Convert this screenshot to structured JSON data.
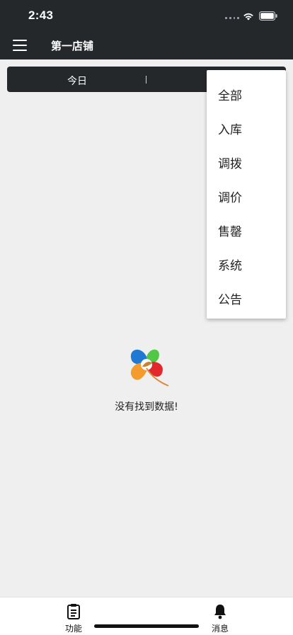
{
  "status_bar": {
    "time": "2:43"
  },
  "app_bar": {
    "title": "第一店铺"
  },
  "segment": {
    "today_label": "今日"
  },
  "dropdown": {
    "items": [
      "全部",
      "入库",
      "调拨",
      "调价",
      "售罄",
      "系统",
      "公告"
    ]
  },
  "empty_state": {
    "message": "没有找到数据!"
  },
  "tab_bar": {
    "function_label": "功能",
    "message_label": "消息"
  },
  "colors": {
    "header_bg": "#25282b",
    "page_bg": "#efefef",
    "menu_bg": "#ffffff"
  }
}
